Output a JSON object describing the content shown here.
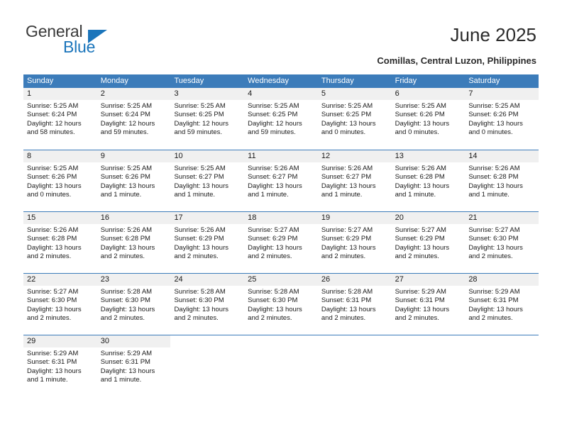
{
  "branding": {
    "name_part1": "General",
    "name_part2": "Blue",
    "accent_color": "#1b75bb"
  },
  "header": {
    "title": "June 2025",
    "location": "Comillas, Central Luzon, Philippines"
  },
  "theme": {
    "header_bg": "#3c7cba",
    "day_number_bg": "#f0f0f0",
    "grid_line": "#3c7cba",
    "text": "#1a1a1a"
  },
  "weekdays": [
    "Sunday",
    "Monday",
    "Tuesday",
    "Wednesday",
    "Thursday",
    "Friday",
    "Saturday"
  ],
  "labels": {
    "sunrise_prefix": "Sunrise:",
    "sunset_prefix": "Sunset:",
    "daylight_prefix": "Daylight:"
  },
  "weeks": [
    [
      {
        "day": "1",
        "sunrise": "Sunrise: 5:25 AM",
        "sunset": "Sunset: 6:24 PM",
        "daylight_line1": "Daylight: 12 hours",
        "daylight_line2": "and 58 minutes."
      },
      {
        "day": "2",
        "sunrise": "Sunrise: 5:25 AM",
        "sunset": "Sunset: 6:24 PM",
        "daylight_line1": "Daylight: 12 hours",
        "daylight_line2": "and 59 minutes."
      },
      {
        "day": "3",
        "sunrise": "Sunrise: 5:25 AM",
        "sunset": "Sunset: 6:25 PM",
        "daylight_line1": "Daylight: 12 hours",
        "daylight_line2": "and 59 minutes."
      },
      {
        "day": "4",
        "sunrise": "Sunrise: 5:25 AM",
        "sunset": "Sunset: 6:25 PM",
        "daylight_line1": "Daylight: 12 hours",
        "daylight_line2": "and 59 minutes."
      },
      {
        "day": "5",
        "sunrise": "Sunrise: 5:25 AM",
        "sunset": "Sunset: 6:25 PM",
        "daylight_line1": "Daylight: 13 hours",
        "daylight_line2": "and 0 minutes."
      },
      {
        "day": "6",
        "sunrise": "Sunrise: 5:25 AM",
        "sunset": "Sunset: 6:26 PM",
        "daylight_line1": "Daylight: 13 hours",
        "daylight_line2": "and 0 minutes."
      },
      {
        "day": "7",
        "sunrise": "Sunrise: 5:25 AM",
        "sunset": "Sunset: 6:26 PM",
        "daylight_line1": "Daylight: 13 hours",
        "daylight_line2": "and 0 minutes."
      }
    ],
    [
      {
        "day": "8",
        "sunrise": "Sunrise: 5:25 AM",
        "sunset": "Sunset: 6:26 PM",
        "daylight_line1": "Daylight: 13 hours",
        "daylight_line2": "and 0 minutes."
      },
      {
        "day": "9",
        "sunrise": "Sunrise: 5:25 AM",
        "sunset": "Sunset: 6:26 PM",
        "daylight_line1": "Daylight: 13 hours",
        "daylight_line2": "and 1 minute."
      },
      {
        "day": "10",
        "sunrise": "Sunrise: 5:25 AM",
        "sunset": "Sunset: 6:27 PM",
        "daylight_line1": "Daylight: 13 hours",
        "daylight_line2": "and 1 minute."
      },
      {
        "day": "11",
        "sunrise": "Sunrise: 5:26 AM",
        "sunset": "Sunset: 6:27 PM",
        "daylight_line1": "Daylight: 13 hours",
        "daylight_line2": "and 1 minute."
      },
      {
        "day": "12",
        "sunrise": "Sunrise: 5:26 AM",
        "sunset": "Sunset: 6:27 PM",
        "daylight_line1": "Daylight: 13 hours",
        "daylight_line2": "and 1 minute."
      },
      {
        "day": "13",
        "sunrise": "Sunrise: 5:26 AM",
        "sunset": "Sunset: 6:28 PM",
        "daylight_line1": "Daylight: 13 hours",
        "daylight_line2": "and 1 minute."
      },
      {
        "day": "14",
        "sunrise": "Sunrise: 5:26 AM",
        "sunset": "Sunset: 6:28 PM",
        "daylight_line1": "Daylight: 13 hours",
        "daylight_line2": "and 1 minute."
      }
    ],
    [
      {
        "day": "15",
        "sunrise": "Sunrise: 5:26 AM",
        "sunset": "Sunset: 6:28 PM",
        "daylight_line1": "Daylight: 13 hours",
        "daylight_line2": "and 2 minutes."
      },
      {
        "day": "16",
        "sunrise": "Sunrise: 5:26 AM",
        "sunset": "Sunset: 6:28 PM",
        "daylight_line1": "Daylight: 13 hours",
        "daylight_line2": "and 2 minutes."
      },
      {
        "day": "17",
        "sunrise": "Sunrise: 5:26 AM",
        "sunset": "Sunset: 6:29 PM",
        "daylight_line1": "Daylight: 13 hours",
        "daylight_line2": "and 2 minutes."
      },
      {
        "day": "18",
        "sunrise": "Sunrise: 5:27 AM",
        "sunset": "Sunset: 6:29 PM",
        "daylight_line1": "Daylight: 13 hours",
        "daylight_line2": "and 2 minutes."
      },
      {
        "day": "19",
        "sunrise": "Sunrise: 5:27 AM",
        "sunset": "Sunset: 6:29 PM",
        "daylight_line1": "Daylight: 13 hours",
        "daylight_line2": "and 2 minutes."
      },
      {
        "day": "20",
        "sunrise": "Sunrise: 5:27 AM",
        "sunset": "Sunset: 6:29 PM",
        "daylight_line1": "Daylight: 13 hours",
        "daylight_line2": "and 2 minutes."
      },
      {
        "day": "21",
        "sunrise": "Sunrise: 5:27 AM",
        "sunset": "Sunset: 6:30 PM",
        "daylight_line1": "Daylight: 13 hours",
        "daylight_line2": "and 2 minutes."
      }
    ],
    [
      {
        "day": "22",
        "sunrise": "Sunrise: 5:27 AM",
        "sunset": "Sunset: 6:30 PM",
        "daylight_line1": "Daylight: 13 hours",
        "daylight_line2": "and 2 minutes."
      },
      {
        "day": "23",
        "sunrise": "Sunrise: 5:28 AM",
        "sunset": "Sunset: 6:30 PM",
        "daylight_line1": "Daylight: 13 hours",
        "daylight_line2": "and 2 minutes."
      },
      {
        "day": "24",
        "sunrise": "Sunrise: 5:28 AM",
        "sunset": "Sunset: 6:30 PM",
        "daylight_line1": "Daylight: 13 hours",
        "daylight_line2": "and 2 minutes."
      },
      {
        "day": "25",
        "sunrise": "Sunrise: 5:28 AM",
        "sunset": "Sunset: 6:30 PM",
        "daylight_line1": "Daylight: 13 hours",
        "daylight_line2": "and 2 minutes."
      },
      {
        "day": "26",
        "sunrise": "Sunrise: 5:28 AM",
        "sunset": "Sunset: 6:31 PM",
        "daylight_line1": "Daylight: 13 hours",
        "daylight_line2": "and 2 minutes."
      },
      {
        "day": "27",
        "sunrise": "Sunrise: 5:29 AM",
        "sunset": "Sunset: 6:31 PM",
        "daylight_line1": "Daylight: 13 hours",
        "daylight_line2": "and 2 minutes."
      },
      {
        "day": "28",
        "sunrise": "Sunrise: 5:29 AM",
        "sunset": "Sunset: 6:31 PM",
        "daylight_line1": "Daylight: 13 hours",
        "daylight_line2": "and 2 minutes."
      }
    ],
    [
      {
        "day": "29",
        "sunrise": "Sunrise: 5:29 AM",
        "sunset": "Sunset: 6:31 PM",
        "daylight_line1": "Daylight: 13 hours",
        "daylight_line2": "and 1 minute."
      },
      {
        "day": "30",
        "sunrise": "Sunrise: 5:29 AM",
        "sunset": "Sunset: 6:31 PM",
        "daylight_line1": "Daylight: 13 hours",
        "daylight_line2": "and 1 minute."
      },
      {
        "day": "",
        "sunrise": "",
        "sunset": "",
        "daylight_line1": "",
        "daylight_line2": ""
      },
      {
        "day": "",
        "sunrise": "",
        "sunset": "",
        "daylight_line1": "",
        "daylight_line2": ""
      },
      {
        "day": "",
        "sunrise": "",
        "sunset": "",
        "daylight_line1": "",
        "daylight_line2": ""
      },
      {
        "day": "",
        "sunrise": "",
        "sunset": "",
        "daylight_line1": "",
        "daylight_line2": ""
      },
      {
        "day": "",
        "sunrise": "",
        "sunset": "",
        "daylight_line1": "",
        "daylight_line2": ""
      }
    ]
  ]
}
